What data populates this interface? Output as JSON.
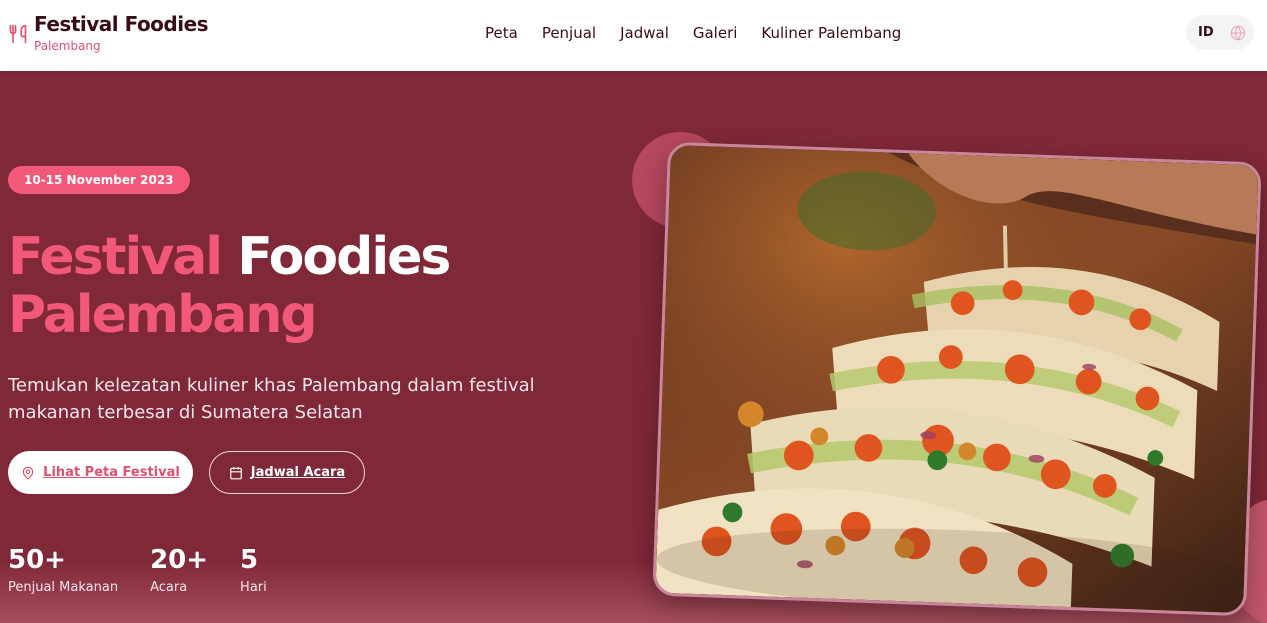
{
  "header": {
    "brand_title": "Festival Foodies",
    "brand_subtitle": "Palembang",
    "nav": [
      "Peta",
      "Penjual",
      "Jadwal",
      "Galeri",
      "Kuliner Palembang"
    ],
    "language": "ID"
  },
  "hero": {
    "date_badge": "10-15 November 2023",
    "title_part1": "Festival",
    "title_part2": "Foodies",
    "title_part3": "Palembang",
    "description": "Temukan kelezatan kuliner khas Palembang dalam festival makanan terbesar di Sumatera Selatan",
    "primary_button": "Lihat Peta Festival",
    "secondary_button": "Jadwal Acara",
    "stats": [
      {
        "value": "50+",
        "label": "Penjual Makanan"
      },
      {
        "value": "20+",
        "label": "Acara"
      },
      {
        "value": "5",
        "label": "Hari"
      }
    ]
  },
  "icons": {
    "logo": "utensils-icon",
    "language": "globe-icon",
    "primary_button": "map-pin-icon",
    "secondary_button": "calendar-icon"
  },
  "colors": {
    "brand_pink": "#f2587a",
    "hero_bg": "#7f2838",
    "dark_text": "#3a0d14"
  }
}
